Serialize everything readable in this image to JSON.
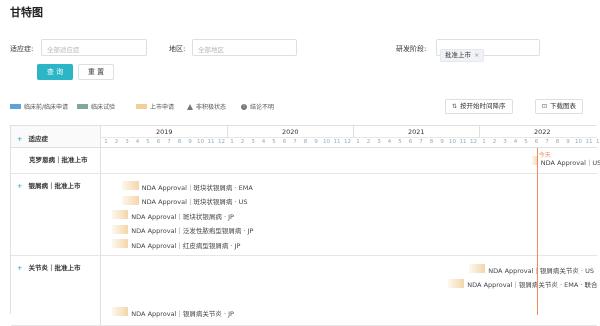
{
  "page": {
    "title": "甘特图"
  },
  "filters": {
    "indication_label": "适应症:",
    "indication_placeholder": "全部适应症",
    "region_label": "地区:",
    "region_placeholder": "全部地区",
    "stage_label": "研发阶段:",
    "stage_tag": "批准上市",
    "stage_tag_close": "×",
    "query_label": "查 询",
    "reset_label": "重 置"
  },
  "legend": [
    {
      "label": "临床前/临床申请",
      "color": "#5ba3d9",
      "kind": "swatch"
    },
    {
      "label": "临床试验",
      "color": "#7fa89a",
      "kind": "swatch"
    },
    {
      "label": "上市申请",
      "color": "#f2cf97",
      "kind": "swatch"
    },
    {
      "label": "非积极状态",
      "color": "#777777",
      "kind": "triangle"
    },
    {
      "label": "结论不明",
      "color": "#777777",
      "kind": "circle"
    }
  ],
  "toolbar": {
    "sort_label": "按开始时间降序",
    "sort_icon": "sort-icon",
    "download_label": "下载图表",
    "download_icon": "download-icon"
  },
  "gantt": {
    "header_label": "适应症",
    "header_plus": "+",
    "years": [
      "2019",
      "2020",
      "2021",
      "2022"
    ],
    "months": [
      "1",
      "2",
      "3",
      "4",
      "5",
      "6",
      "7",
      "8",
      "9",
      "10",
      "11",
      "12"
    ],
    "today_label": "今天",
    "groups": [
      {
        "label": "克罗恩病｜批准上市",
        "plus": "",
        "rows": [
          {
            "text": "NDA Approval｜US",
            "start": "2022-06",
            "span": 0.6
          }
        ]
      },
      {
        "label": "银屑病｜批准上市",
        "plus": "+",
        "rows": [
          {
            "text": "NDA Approval｜斑块状银屑病 · EMA",
            "start": "2019-03",
            "span": 1.6
          },
          {
            "text": "NDA Approval｜斑块状银屑病 · US",
            "start": "2019-03",
            "span": 1.6
          },
          {
            "text": "NDA Approval｜斑块状银屑病 · JP",
            "start": "2019-02",
            "span": 1.6
          },
          {
            "text": "NDA Approval｜泛发性脓疱型银屑病 · JP",
            "start": "2019-02",
            "span": 1.6
          },
          {
            "text": "NDA Approval｜红皮病型银屑病 · JP",
            "start": "2019-02",
            "span": 1.6
          }
        ]
      },
      {
        "label": "关节炎｜批准上市",
        "plus": "+",
        "rows": [
          {
            "text": "NDA Approval｜银屑病关节炎 · US",
            "start": "2021-12",
            "span": 1.6
          },
          {
            "text": "NDA Approval｜银屑病关节炎 · EMA · 联合",
            "start": "2021-10",
            "span": 1.6
          },
          {
            "text": "NDA Approval｜银屑病关节炎 · JP",
            "start": "2019-02",
            "span": 1.6
          }
        ]
      }
    ]
  }
}
